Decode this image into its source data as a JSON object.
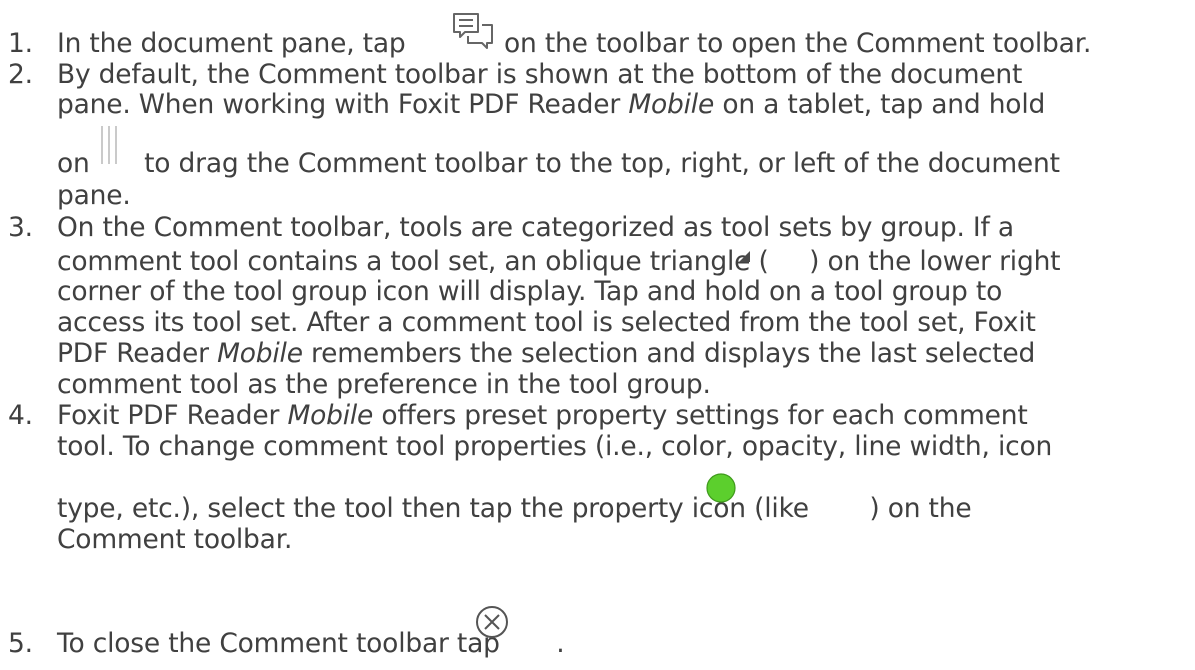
{
  "steps": [
    {
      "number": "1.",
      "l1_a": "In the document pane, tap",
      "l1_b": "on the toolbar to open the Comment toolbar.",
      "icon": "comment-toolbar-icon"
    },
    {
      "number": "2.",
      "l1": "By default, the Comment toolbar is shown at the bottom of the document",
      "l2_a": "pane. When working with Foxit PDF Reader",
      "l2_em": "Mobile",
      "l2_b": "on a tablet, tap and hold",
      "l3_a": "on",
      "l3_b": "to drag the Comment toolbar to the top, right, or left of the document",
      "l4": "pane.",
      "icon": "drag-handle-icon"
    },
    {
      "number": "3.",
      "l1": "On the Comment toolbar, tools are categorized as tool sets by group. If a",
      "l2_a": "comment tool contains a tool set, an oblique triangle (",
      "l2_b": ") on the lower right",
      "l3": "corner of the tool group icon will display. Tap and hold on a tool group to",
      "l4": "access its tool set. After a comment tool is selected from the tool set, Foxit",
      "l5_a": "PDF Reader",
      "l5_em": "Mobile",
      "l5_b": "remembers the selection and displays the last selected",
      "l6": "comment tool as the preference in the tool group.",
      "icon": "oblique-triangle-icon"
    },
    {
      "number": "4.",
      "l1_a": "Foxit PDF Reader",
      "l1_em": "Mobile",
      "l1_b": "offers preset property settings for each comment",
      "l2": "tool. To change comment tool properties (i.e., color, opacity, line width, icon",
      "l3_a": "type, etc.), select the tool then tap the property icon (like",
      "l3_b": ") on the",
      "l4": "Comment toolbar.",
      "icon": "green-circle-property-icon",
      "icon_color": "#5ccf2d"
    },
    {
      "number": "5.",
      "l1_a": "To close the Comment toolbar tap",
      "l1_b": ".",
      "icon": "close-circle-x-icon"
    }
  ]
}
